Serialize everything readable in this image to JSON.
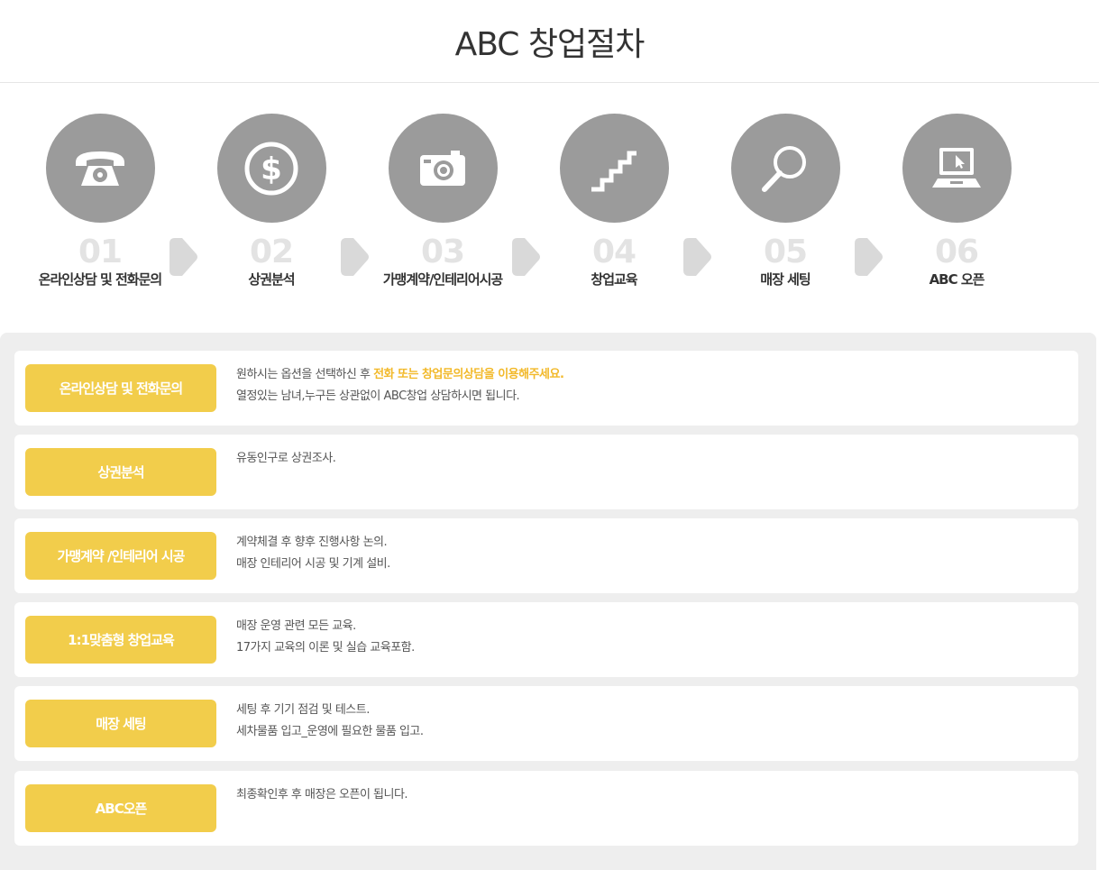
{
  "header": {
    "title": "ABC 창업절차"
  },
  "steps": [
    {
      "num": "01",
      "label": "온라인상담 및 전화문의",
      "icon": "telephone-icon"
    },
    {
      "num": "02",
      "label": "상권분석",
      "icon": "dollar-icon"
    },
    {
      "num": "03",
      "label": "가맹계약/인테리어시공",
      "icon": "camera-icon"
    },
    {
      "num": "04",
      "label": "창업교육",
      "icon": "stairs-icon"
    },
    {
      "num": "05",
      "label": "매장 세팅",
      "icon": "magnifier-icon"
    },
    {
      "num": "06",
      "label": "ABC 오픈",
      "icon": "laptop-icon"
    }
  ],
  "details": [
    {
      "badge": "온라인상담 및 전화문의",
      "line1_pre": "원하시는 옵션을 선택하신 후 ",
      "line1_hl": "전화 또는 창업문의상담을 이용해주세요.",
      "line2": "열정있는 남녀,누구든 상관없이 ABC창업 상담하시면 됩니다."
    },
    {
      "badge": "상권분석",
      "line1": "유동인구로 상권조사."
    },
    {
      "badge": "가맹계약 /인테리어 시공",
      "line1": "계약체결 후 향후 진행사항 논의.",
      "line2": "매장 인테리어 시공 및 기계 설비."
    },
    {
      "badge": "1:1맞춤형 창업교육",
      "line1": "매장 운영 관련 모든 교육.",
      "line2": "17가지 교육의 이론 및 실습 교육포함."
    },
    {
      "badge": "매장 세팅",
      "line1": "세팅 후 기기 점검 및 테스트.",
      "line2": "세차물품 입고_운영에 필요한 물품 입고."
    },
    {
      "badge": "ABC오픈",
      "line1": "최종확인후 후 매장은 오픈이 됩니다."
    }
  ],
  "colors": {
    "accent": "#f2cd4b",
    "highlight": "#f2b92a",
    "circle": "#9b9b9b",
    "arrow": "#d9d9d9",
    "number": "#e3e3e3"
  }
}
